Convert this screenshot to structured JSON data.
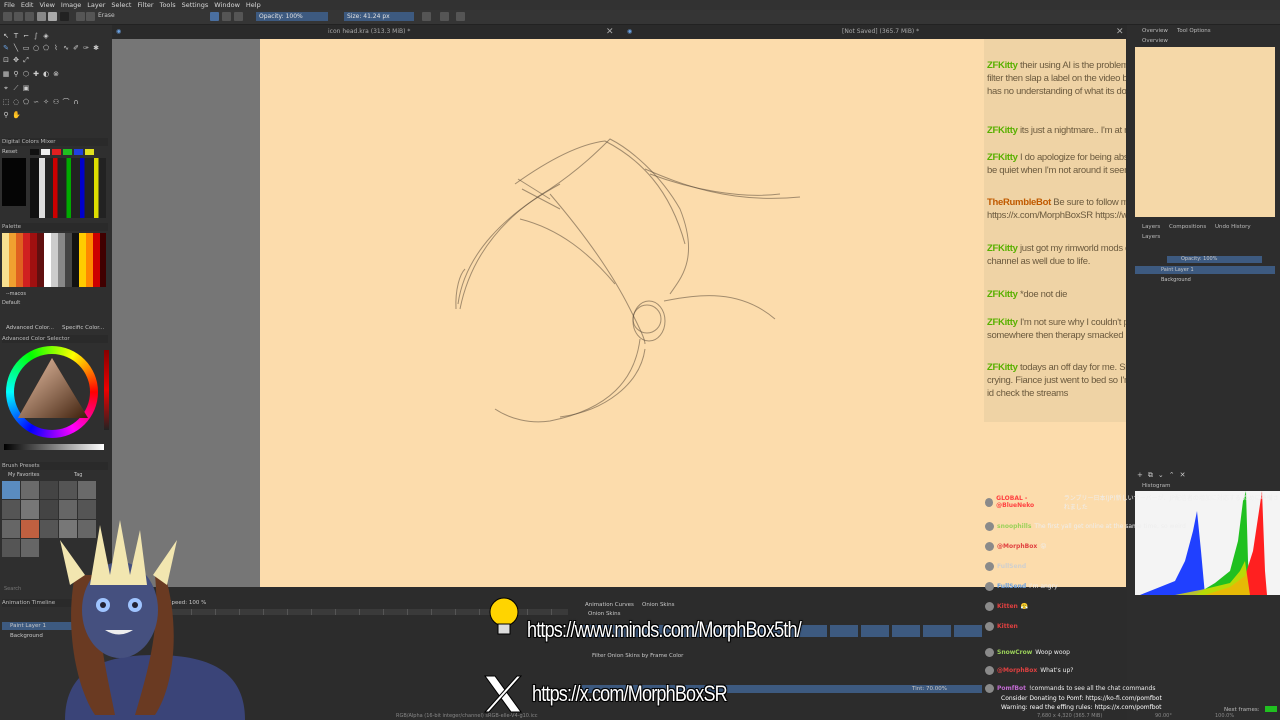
{
  "menu": [
    "File",
    "Edit",
    "View",
    "Image",
    "Layer",
    "Select",
    "Filter",
    "Tools",
    "Settings",
    "Window",
    "Help"
  ],
  "toolbar": {
    "blend_mode": "Erase",
    "opacity": "Opacity: 100%",
    "size": "Size: 41.24 px"
  },
  "tabs": [
    {
      "label": "icon head.kra (313.3 MiB) *"
    },
    {
      "label": "[Not Saved]  (365.7 MiB) *"
    }
  ],
  "left_dock": {
    "digital_mixer": "Digital Colors Mixer",
    "reset": "Reset",
    "palette": "Palette",
    "palette_name": "--macos",
    "default": "Default",
    "adv_color": "Advanced Color...",
    "specific_color": "Specific Color...",
    "adv_color_selector": "Advanced Color Selector",
    "brush_presets": "Brush Presets",
    "favorites": "My Favorites",
    "tag": "Tag",
    "search": "Search",
    "animation_timeline": "Animation Timeline",
    "layers": [
      "Paint Layer 1",
      "Background"
    ]
  },
  "canvas_chat": [
    {
      "name": "ZFKitty",
      "text": "their using AI is the problem. Its looking for text or words that fit in a filter then slap a label on the video based on an AI generated description. It has no understanding of what its doing."
    },
    {
      "name": "ZFKitty",
      "text": "its just a nightmare.. I'm at risk of it myself."
    },
    {
      "name": "ZFKitty",
      "text": "I do apologize for being absent for so long as well. Rumble tends to be quiet when I'm not around it seems."
    },
    {
      "name": "TheRumbleBot",
      "text": "Be sure to follow me on my socials: https://x.com/MorphBoxSR https://www.minds.com/MorphBox5th/"
    },
    {
      "name": "ZFKitty",
      "text": "just got my rimworld mods done, had to put Refrain on hold for my channel as well due to life."
    },
    {
      "name": "ZFKitty",
      "text": "*doe not die"
    },
    {
      "name": "ZFKitty",
      "text": "I'm not sure why I couldn't push through it.. brain just went somewhere then therapy smacked me."
    },
    {
      "name": "ZFKitty",
      "text": "todays an off day for me. Sick physically and emotionally, spent time crying. Fiance just went to bed so I'm just.. stuck trying to calm down, figured id check the streams"
    }
  ],
  "right_dock": {
    "overview": "Overview",
    "tool_options": "Tool Options",
    "layers_tab": "Layers",
    "compositions": "Compositions",
    "undo_history": "Undo History",
    "opacity": "Opacity: 100%",
    "layer_list": [
      "Paint Layer 1",
      "Background"
    ],
    "histogram": "Histogram",
    "next_frames": "Next frames:"
  },
  "timeline": {
    "speed": "Speed: 100 %",
    "animation_curves": "Animation Curves",
    "onion_skins": "Onion Skins",
    "onion_skins_label": "Onion Skins",
    "filter_onion": "Filter Onion Skins by Frame Color",
    "tint": "Tint: 70.00%"
  },
  "overlay": {
    "minds_url": "https://www.minds.com/MorphBox5th/",
    "x_url": "https://x.com/MorphBoxSR"
  },
  "status": {
    "color_space": "RGB/Alpha (16-bit integer/channel)  sRGB-elle-V4-g10.icc",
    "dims": "7,680 x 4,320 (365.7 MiB)",
    "rotation": "90.00°",
    "zoom": "100.0%"
  },
  "right_chat": [
    {
      "name": "GLOBAL - @BlueNeko",
      "text": "ランブリー日本(JP)新しいサーバーが、JP配信者の増加に対応する ために準備されました",
      "color": "#ff4040"
    },
    {
      "name": "snoophills",
      "text": "The first yall get online at the same time, so weird",
      "color": "#9bd15a"
    },
    {
      "name": "@MorphBox",
      "text": "😝",
      "color": "#e04040"
    },
    {
      "name": "FullSend",
      "text": "",
      "color": "#cfcfcf"
    },
    {
      "name": "FullSend",
      "text": "I'm angry",
      "color": "#6aa0e0"
    },
    {
      "name": "Kitten",
      "text": "😤",
      "color": "#e04040"
    },
    {
      "name": "Kitten",
      "text": "",
      "color": "#e04040"
    },
    {
      "name": "SnowCrow",
      "text": "Woop woop",
      "color": "#9bd15a"
    },
    {
      "name": "@MorphBox",
      "text": "What's up?",
      "color": "#e04040"
    },
    {
      "name": "PomfBot",
      "text": "!commands to see all the chat commands",
      "color": "#c06ad0"
    },
    {
      "name": "",
      "text": "Consider Donating to Pomf: https://ko-fi.com/pomfbot",
      "color": "#ffffff"
    },
    {
      "name": "",
      "text": "Warning: read the effing rules: https://x.com/pomfbot",
      "color": "#ffffff"
    }
  ],
  "colors": {
    "canvas": "#fcdcac",
    "chat_name": "#58b000",
    "chat_text": "#6b5a3e",
    "ui_bg": "#2f2f2f",
    "accent": "#3d5a80"
  }
}
